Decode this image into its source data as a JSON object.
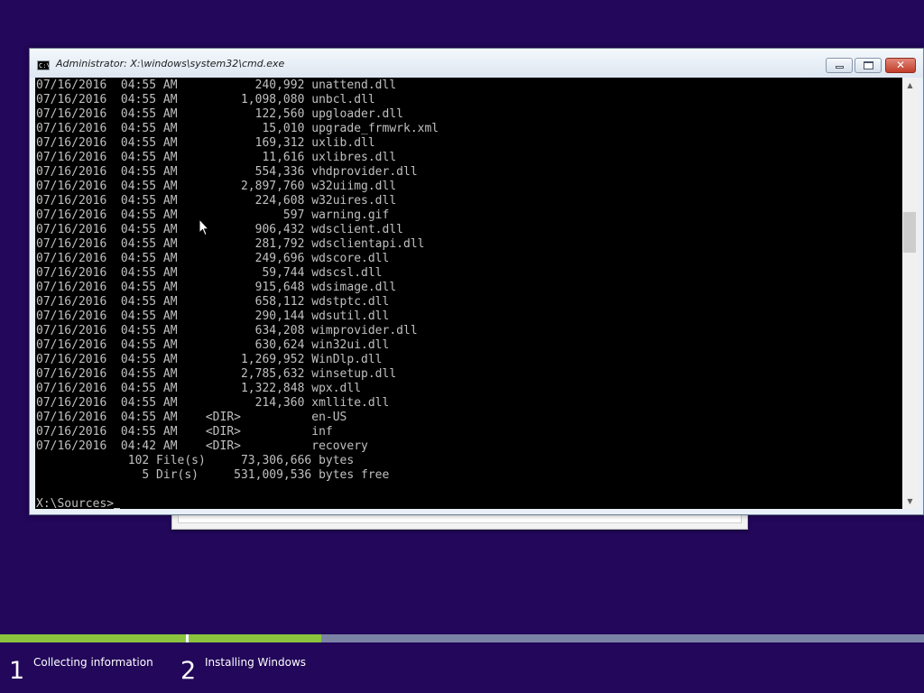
{
  "window": {
    "title": "Administrator: X:\\windows\\system32\\cmd.exe",
    "icon_text": "C:\\",
    "icon": "console-icon",
    "buttons": {
      "minimize": "minimize-icon",
      "maximize": "maximize-icon",
      "close": "close-icon",
      "close_glyph": "✕"
    }
  },
  "console": {
    "lines": [
      "07/16/2016  04:55 AM           240,992 unattend.dll",
      "07/16/2016  04:55 AM         1,098,080 unbcl.dll",
      "07/16/2016  04:55 AM           122,560 upgloader.dll",
      "07/16/2016  04:55 AM            15,010 upgrade_frmwrk.xml",
      "07/16/2016  04:55 AM           169,312 uxlib.dll",
      "07/16/2016  04:55 AM            11,616 uxlibres.dll",
      "07/16/2016  04:55 AM           554,336 vhdprovider.dll",
      "07/16/2016  04:55 AM         2,897,760 w32uiimg.dll",
      "07/16/2016  04:55 AM           224,608 w32uires.dll",
      "07/16/2016  04:55 AM               597 warning.gif",
      "07/16/2016  04:55 AM           906,432 wdsclient.dll",
      "07/16/2016  04:55 AM           281,792 wdsclientapi.dll",
      "07/16/2016  04:55 AM           249,696 wdscore.dll",
      "07/16/2016  04:55 AM            59,744 wdscsl.dll",
      "07/16/2016  04:55 AM           915,648 wdsimage.dll",
      "07/16/2016  04:55 AM           658,112 wdstptc.dll",
      "07/16/2016  04:55 AM           290,144 wdsutil.dll",
      "07/16/2016  04:55 AM           634,208 wimprovider.dll",
      "07/16/2016  04:55 AM           630,624 win32ui.dll",
      "07/16/2016  04:55 AM         1,269,952 WinDlp.dll",
      "07/16/2016  04:55 AM         2,785,632 winsetup.dll",
      "07/16/2016  04:55 AM         1,322,848 wpx.dll",
      "07/16/2016  04:55 AM           214,360 xmllite.dll",
      "07/16/2016  04:55 AM    <DIR>          en-US",
      "07/16/2016  04:55 AM    <DIR>          inf",
      "07/16/2016  04:42 AM    <DIR>          recovery",
      "             102 File(s)     73,306,666 bytes",
      "               5 Dir(s)     531,009,536 bytes free",
      "",
      "X:\\Sources>"
    ]
  },
  "scrollbar": {
    "up_glyph": "▲",
    "down_glyph": "▼"
  },
  "setup": {
    "steps": [
      {
        "number": "1",
        "label": "Collecting information",
        "progress": 1.0
      },
      {
        "number": "2",
        "label": "Installing Windows",
        "progress": 0.18
      }
    ]
  },
  "colors": {
    "desktop": "#22075a",
    "console_bg": "#000000",
    "console_text": "#c0c0c0",
    "progress_done": "#8bc43f",
    "progress_track": "#7b83a5"
  }
}
